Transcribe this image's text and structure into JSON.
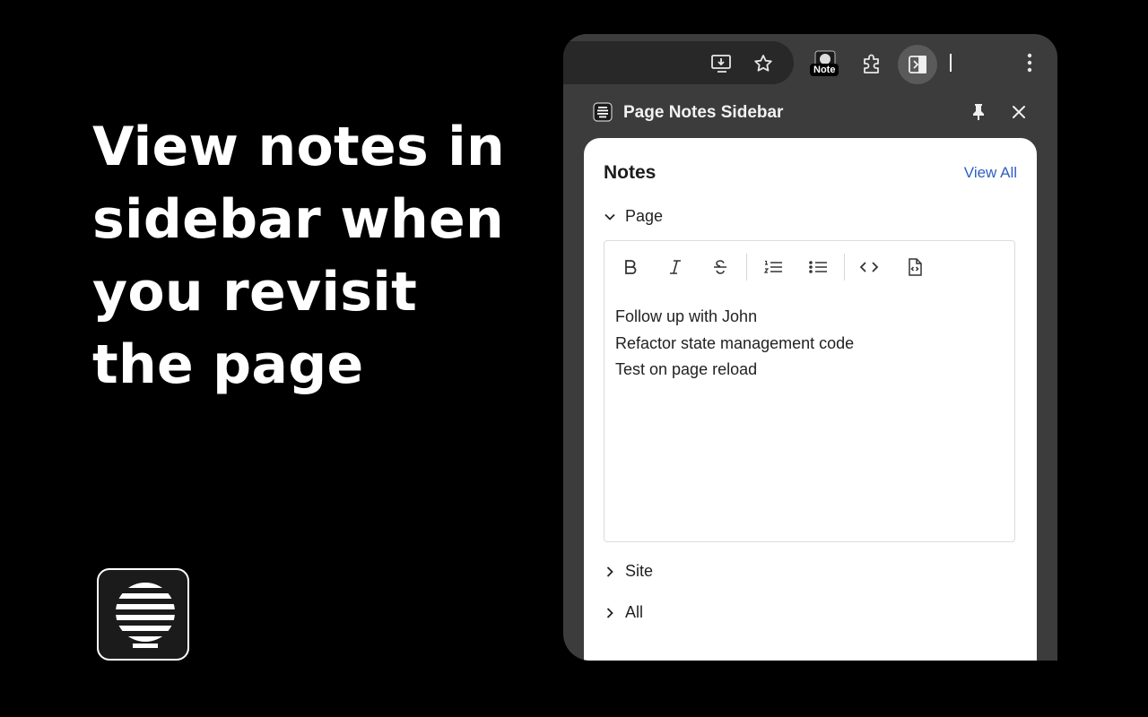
{
  "headline": "View notes in sidebar when you revisit the page",
  "browser": {
    "toolbar": {
      "icons": [
        "install-app-icon",
        "bookmark-star-icon",
        "extension-note-icon",
        "extensions-puzzle-icon",
        "side-panel-icon",
        "more-menu-icon"
      ],
      "note_badge": "Note"
    },
    "panel": {
      "title": "Page Notes Sidebar",
      "icons": [
        "pin-icon",
        "close-icon"
      ]
    }
  },
  "notes": {
    "title": "Notes",
    "view_all": "View All",
    "sections": [
      {
        "label": "Page",
        "expanded": true
      },
      {
        "label": "Site",
        "expanded": false
      },
      {
        "label": "All",
        "expanded": false
      }
    ],
    "editor": {
      "toolbar_icons": [
        "bold-icon",
        "italic-icon",
        "strikethrough-icon",
        "ordered-list-icon",
        "bullet-list-icon",
        "code-icon",
        "code-block-icon"
      ],
      "lines": [
        "Follow up with John",
        "Refactor state management code",
        "Test on page reload"
      ]
    }
  },
  "colors": {
    "background": "#000000",
    "browser_chrome": "#3c3c3c",
    "link": "#2d5fc4"
  }
}
